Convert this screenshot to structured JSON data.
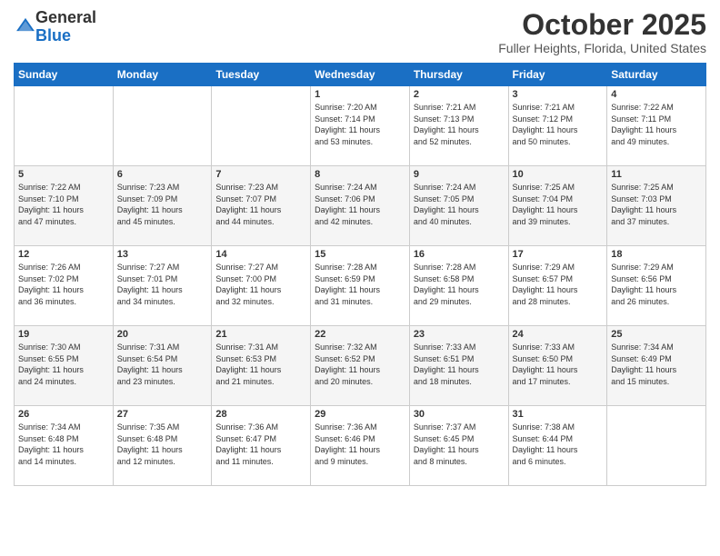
{
  "header": {
    "logo_general": "General",
    "logo_blue": "Blue",
    "month": "October 2025",
    "location": "Fuller Heights, Florida, United States"
  },
  "days_of_week": [
    "Sunday",
    "Monday",
    "Tuesday",
    "Wednesday",
    "Thursday",
    "Friday",
    "Saturday"
  ],
  "weeks": [
    [
      {
        "day": "",
        "info": ""
      },
      {
        "day": "",
        "info": ""
      },
      {
        "day": "",
        "info": ""
      },
      {
        "day": "1",
        "info": "Sunrise: 7:20 AM\nSunset: 7:14 PM\nDaylight: 11 hours\nand 53 minutes."
      },
      {
        "day": "2",
        "info": "Sunrise: 7:21 AM\nSunset: 7:13 PM\nDaylight: 11 hours\nand 52 minutes."
      },
      {
        "day": "3",
        "info": "Sunrise: 7:21 AM\nSunset: 7:12 PM\nDaylight: 11 hours\nand 50 minutes."
      },
      {
        "day": "4",
        "info": "Sunrise: 7:22 AM\nSunset: 7:11 PM\nDaylight: 11 hours\nand 49 minutes."
      }
    ],
    [
      {
        "day": "5",
        "info": "Sunrise: 7:22 AM\nSunset: 7:10 PM\nDaylight: 11 hours\nand 47 minutes."
      },
      {
        "day": "6",
        "info": "Sunrise: 7:23 AM\nSunset: 7:09 PM\nDaylight: 11 hours\nand 45 minutes."
      },
      {
        "day": "7",
        "info": "Sunrise: 7:23 AM\nSunset: 7:07 PM\nDaylight: 11 hours\nand 44 minutes."
      },
      {
        "day": "8",
        "info": "Sunrise: 7:24 AM\nSunset: 7:06 PM\nDaylight: 11 hours\nand 42 minutes."
      },
      {
        "day": "9",
        "info": "Sunrise: 7:24 AM\nSunset: 7:05 PM\nDaylight: 11 hours\nand 40 minutes."
      },
      {
        "day": "10",
        "info": "Sunrise: 7:25 AM\nSunset: 7:04 PM\nDaylight: 11 hours\nand 39 minutes."
      },
      {
        "day": "11",
        "info": "Sunrise: 7:25 AM\nSunset: 7:03 PM\nDaylight: 11 hours\nand 37 minutes."
      }
    ],
    [
      {
        "day": "12",
        "info": "Sunrise: 7:26 AM\nSunset: 7:02 PM\nDaylight: 11 hours\nand 36 minutes."
      },
      {
        "day": "13",
        "info": "Sunrise: 7:27 AM\nSunset: 7:01 PM\nDaylight: 11 hours\nand 34 minutes."
      },
      {
        "day": "14",
        "info": "Sunrise: 7:27 AM\nSunset: 7:00 PM\nDaylight: 11 hours\nand 32 minutes."
      },
      {
        "day": "15",
        "info": "Sunrise: 7:28 AM\nSunset: 6:59 PM\nDaylight: 11 hours\nand 31 minutes."
      },
      {
        "day": "16",
        "info": "Sunrise: 7:28 AM\nSunset: 6:58 PM\nDaylight: 11 hours\nand 29 minutes."
      },
      {
        "day": "17",
        "info": "Sunrise: 7:29 AM\nSunset: 6:57 PM\nDaylight: 11 hours\nand 28 minutes."
      },
      {
        "day": "18",
        "info": "Sunrise: 7:29 AM\nSunset: 6:56 PM\nDaylight: 11 hours\nand 26 minutes."
      }
    ],
    [
      {
        "day": "19",
        "info": "Sunrise: 7:30 AM\nSunset: 6:55 PM\nDaylight: 11 hours\nand 24 minutes."
      },
      {
        "day": "20",
        "info": "Sunrise: 7:31 AM\nSunset: 6:54 PM\nDaylight: 11 hours\nand 23 minutes."
      },
      {
        "day": "21",
        "info": "Sunrise: 7:31 AM\nSunset: 6:53 PM\nDaylight: 11 hours\nand 21 minutes."
      },
      {
        "day": "22",
        "info": "Sunrise: 7:32 AM\nSunset: 6:52 PM\nDaylight: 11 hours\nand 20 minutes."
      },
      {
        "day": "23",
        "info": "Sunrise: 7:33 AM\nSunset: 6:51 PM\nDaylight: 11 hours\nand 18 minutes."
      },
      {
        "day": "24",
        "info": "Sunrise: 7:33 AM\nSunset: 6:50 PM\nDaylight: 11 hours\nand 17 minutes."
      },
      {
        "day": "25",
        "info": "Sunrise: 7:34 AM\nSunset: 6:49 PM\nDaylight: 11 hours\nand 15 minutes."
      }
    ],
    [
      {
        "day": "26",
        "info": "Sunrise: 7:34 AM\nSunset: 6:48 PM\nDaylight: 11 hours\nand 14 minutes."
      },
      {
        "day": "27",
        "info": "Sunrise: 7:35 AM\nSunset: 6:48 PM\nDaylight: 11 hours\nand 12 minutes."
      },
      {
        "day": "28",
        "info": "Sunrise: 7:36 AM\nSunset: 6:47 PM\nDaylight: 11 hours\nand 11 minutes."
      },
      {
        "day": "29",
        "info": "Sunrise: 7:36 AM\nSunset: 6:46 PM\nDaylight: 11 hours\nand 9 minutes."
      },
      {
        "day": "30",
        "info": "Sunrise: 7:37 AM\nSunset: 6:45 PM\nDaylight: 11 hours\nand 8 minutes."
      },
      {
        "day": "31",
        "info": "Sunrise: 7:38 AM\nSunset: 6:44 PM\nDaylight: 11 hours\nand 6 minutes."
      },
      {
        "day": "",
        "info": ""
      }
    ]
  ]
}
